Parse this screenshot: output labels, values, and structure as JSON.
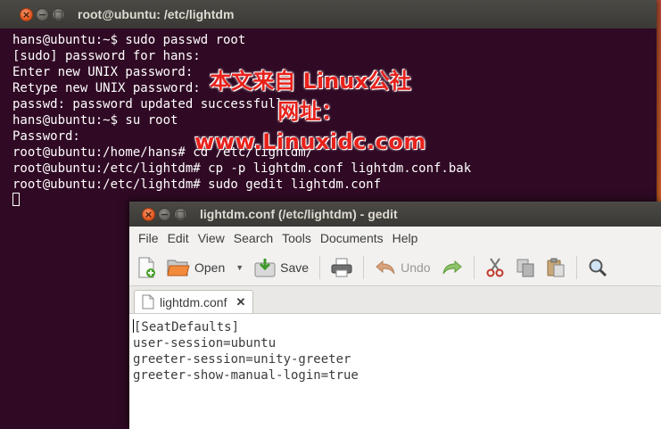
{
  "terminal": {
    "title": "root@ubuntu: /etc/lightdm",
    "lines": [
      "hans@ubuntu:~$ sudo passwd root",
      "[sudo] password for hans:",
      "Enter new UNIX password:",
      "Retype new UNIX password:",
      "passwd: password updated successfully",
      "hans@ubuntu:~$ su root",
      "Password:",
      "root@ubuntu:/home/hans# cd /etc/lightdm/",
      "root@ubuntu:/etc/lightdm# cp -p lightdm.conf lightdm.conf.bak",
      "root@ubuntu:/etc/lightdm# sudo gedit lightdm.conf"
    ]
  },
  "watermark": {
    "line1": "本文来自 Linux公社",
    "line2": "网址：www.Linuxidc.com"
  },
  "gedit": {
    "title": "lightdm.conf (/etc/lightdm) - gedit",
    "menu": [
      "File",
      "Edit",
      "View",
      "Search",
      "Tools",
      "Documents",
      "Help"
    ],
    "toolbar": {
      "open_label": "Open",
      "save_label": "Save",
      "undo_label": "Undo"
    },
    "tab_label": "lightdm.conf",
    "content": [
      "[SeatDefaults]",
      "user-session=ubuntu",
      "greeter-session=unity-greeter",
      "greeter-show-manual-login=true"
    ]
  },
  "colors": {
    "terminal_bg": "#300a24",
    "titlebar": "#3c3b37",
    "close_button": "#e9541f",
    "watermark": "#e8211b"
  }
}
